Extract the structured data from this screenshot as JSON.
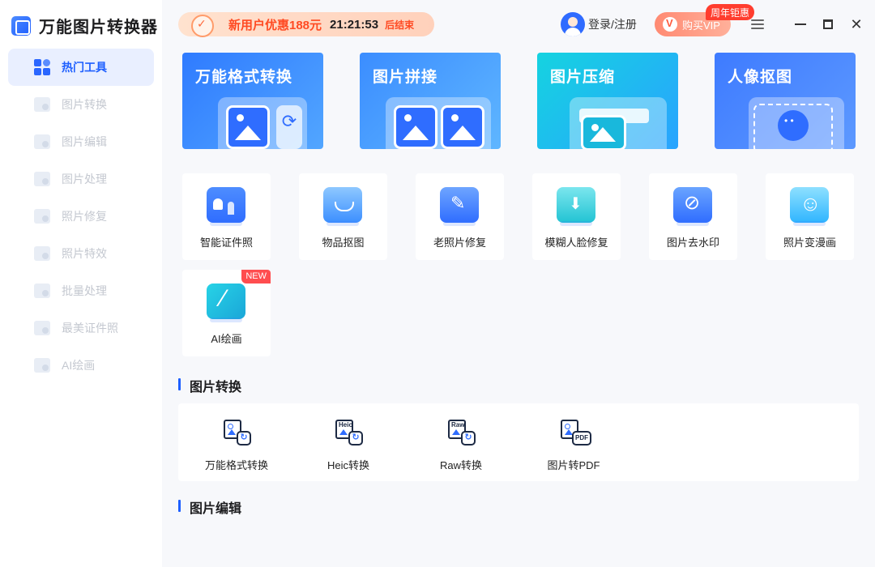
{
  "app": {
    "title": "万能图片转换器"
  },
  "sidebar": {
    "items": [
      {
        "label": "热门工具",
        "active": true
      },
      {
        "label": "图片转换"
      },
      {
        "label": "图片编辑"
      },
      {
        "label": "图片处理"
      },
      {
        "label": "照片修复"
      },
      {
        "label": "照片特效"
      },
      {
        "label": "批量处理"
      },
      {
        "label": "最美证件照"
      },
      {
        "label": "AI绘画"
      }
    ]
  },
  "header": {
    "promo": {
      "text": "新用户优惠188元",
      "time": "21:21:53",
      "end": "后结束"
    },
    "login": "登录/注册",
    "vip": {
      "label": "购买VIP",
      "badge": "周年钜惠"
    }
  },
  "features": [
    {
      "title": "万能格式转换"
    },
    {
      "title": "图片拼接"
    },
    {
      "title": "图片压缩"
    },
    {
      "title": "人像抠图"
    }
  ],
  "tools": [
    {
      "label": "智能证件照",
      "icon": "id-card-icon"
    },
    {
      "label": "物品抠图",
      "icon": "bag-icon"
    },
    {
      "label": "老照片修复",
      "icon": "wrench-icon"
    },
    {
      "label": "模糊人脸修复",
      "icon": "face-icon"
    },
    {
      "label": "图片去水印",
      "icon": "watermark-icon"
    },
    {
      "label": "照片变漫画",
      "icon": "anime-icon"
    },
    {
      "label": "AI绘画",
      "icon": "ai-paint-icon",
      "badge": "NEW"
    }
  ],
  "sections": {
    "convert": {
      "title": "图片转换",
      "items": [
        {
          "label": "万能格式转换",
          "tag": ""
        },
        {
          "label": "Heic转换",
          "tag": "Heic"
        },
        {
          "label": "Raw转换",
          "tag": "Raw"
        },
        {
          "label": "图片转PDF",
          "tag": "PDF"
        }
      ]
    },
    "edit": {
      "title": "图片编辑"
    }
  },
  "colors": {
    "accent": "#1e5fff",
    "promo": "#ff4a22",
    "vip": "#ff8a72",
    "new_badge": "#ff4d4f"
  }
}
